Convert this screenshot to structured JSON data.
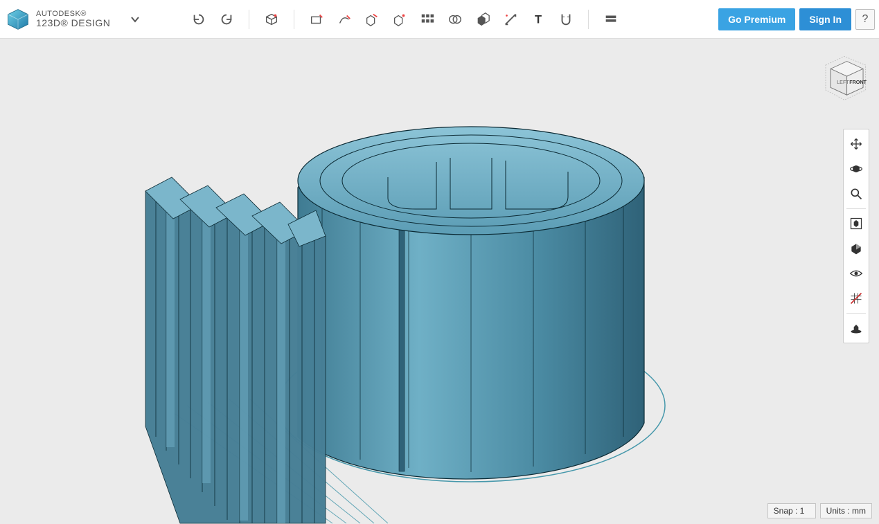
{
  "header": {
    "brand": "AUTODESK®",
    "product": "123D® DESIGN",
    "go_premium": "Go Premium",
    "sign_in": "Sign In",
    "help": "?"
  },
  "toolbar": {
    "undo": "undo",
    "redo": "redo",
    "primitives": "primitives",
    "sketch": "sketch",
    "draw": "draw",
    "construct": "construct",
    "modify": "modify",
    "pattern": "pattern",
    "group": "group",
    "combine": "combine",
    "measure": "measure",
    "text": "text",
    "snap_tool": "snap",
    "material": "material"
  },
  "viewcube": {
    "left": "LEFT",
    "front": "FRONT"
  },
  "right_tools": {
    "pan": "pan",
    "orbit": "orbit",
    "zoom": "zoom",
    "fit": "fit",
    "shade": "shade",
    "visibility": "visibility",
    "grid": "grid",
    "ground": "ground"
  },
  "status": {
    "snap_label": "Snap : 1",
    "units_label": "Units : mm"
  },
  "colors": {
    "model_fill": "#5b99b3",
    "model_stroke": "#0b2a34",
    "shadow": "#2a8aa0",
    "accent": "#3aa3e3"
  }
}
